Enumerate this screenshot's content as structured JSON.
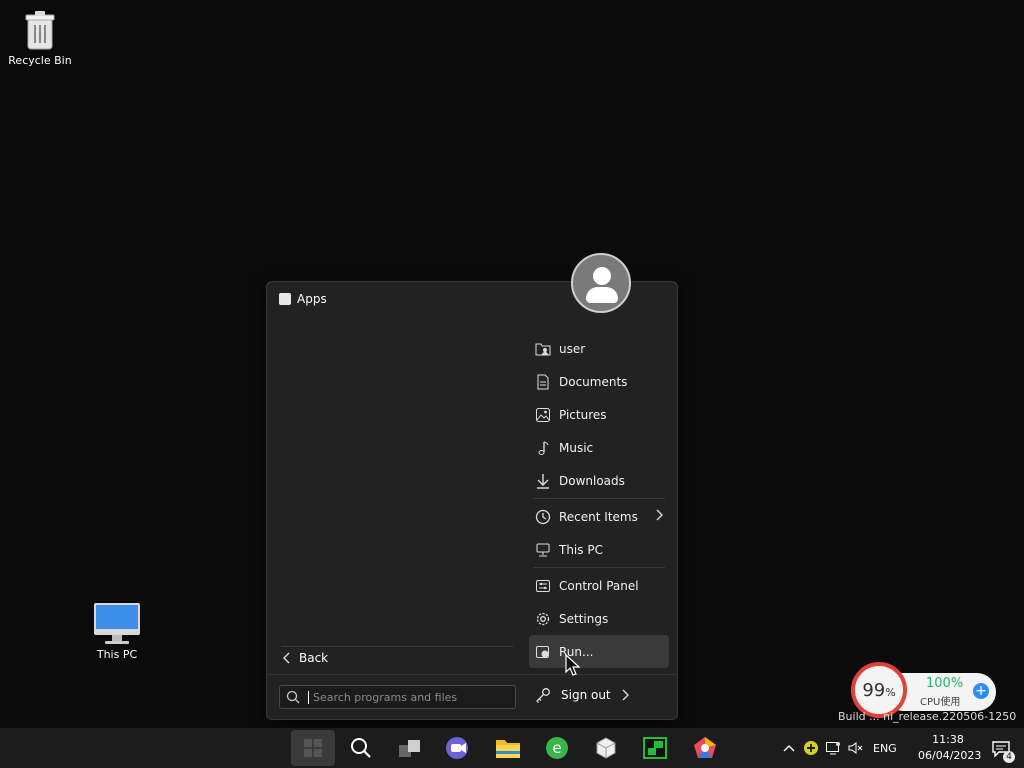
{
  "desktop": {
    "icons": [
      {
        "label": "Recycle Bin"
      },
      {
        "label": "This PC"
      }
    ]
  },
  "start_menu": {
    "apps_title": "Apps",
    "right_items": [
      {
        "label": "user",
        "icon": "user-folder-icon"
      },
      {
        "label": "Documents",
        "icon": "document-icon"
      },
      {
        "label": "Pictures",
        "icon": "picture-icon"
      },
      {
        "label": "Music",
        "icon": "music-note-icon"
      },
      {
        "label": "Downloads",
        "icon": "download-arrow-icon"
      },
      {
        "label": "Recent Items",
        "icon": "clock-icon"
      },
      {
        "label": "This PC",
        "icon": "computer-icon"
      },
      {
        "label": "Control Panel",
        "icon": "control-panel-icon"
      },
      {
        "label": "Settings",
        "icon": "gear-icon"
      },
      {
        "label": "Run...",
        "icon": "run-icon"
      }
    ],
    "back_label": "Back",
    "search_placeholder": "Search programs and files",
    "signout_label": "Sign out"
  },
  "cpu_widget": {
    "memory_percent": "99",
    "memory_unit": "%",
    "cpu_percent": "100%",
    "cpu_label": "CPU使用",
    "build_text": "Build ... ni_release.220506-1250"
  },
  "taskbar": {
    "language": "ENG",
    "time": "11:38",
    "date": "06/04/2023",
    "notification_count": "4"
  },
  "colors": {
    "desktop_bg": "#0b0b0b",
    "menu_bg": "#222222",
    "taskbar_bg": "#1c1c1c",
    "cpu_red": "#e0423a",
    "cpu_green": "#26b36b",
    "accent_blue": "#2b8ef1"
  }
}
